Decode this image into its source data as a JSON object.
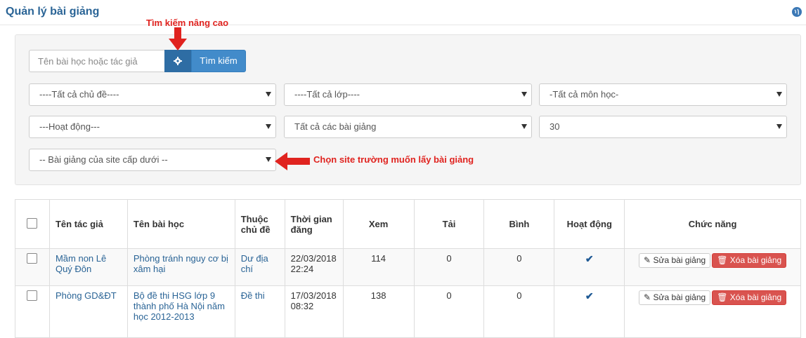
{
  "header": {
    "title": "Quản lý bài giảng"
  },
  "search": {
    "placeholder": "Tên bài học hoặc tác giả",
    "button_label": "Tìm kiếm"
  },
  "filters": {
    "topic": "----Tất cả chủ đề----",
    "grade": "----Tất cả lớp----",
    "subject": "-Tất cả môn học-",
    "status": "---Hoạt động---",
    "lesson_type": "Tất cả các bài giảng",
    "page_size": "30",
    "site": "-- Bài giảng của site cấp dưới --"
  },
  "annotations": {
    "advanced_search": "Tìm kiếm nâng cao",
    "choose_site": "Chọn site trường muốn lấy bài giảng"
  },
  "table": {
    "headers": {
      "author": "Tên tác giả",
      "lesson": "Tên bài học",
      "topic_1": "Thuộc",
      "topic_2": "chủ đề",
      "date_1": "Thời gian",
      "date_2": "đăng",
      "views": "Xem",
      "downloads": "Tải",
      "comments": "Bình",
      "active": "Hoạt động",
      "actions": "Chức năng"
    },
    "edit_label": "Sửa bài giảng",
    "delete_label": "Xóa bài giảng",
    "rows": [
      {
        "author": "Mầm non Lê Quý Đôn",
        "lesson": "Phòng tránh nguy cơ bị xâm hại",
        "topic": "Dư địa chí",
        "date": "22/03/2018",
        "time": "22:24",
        "views": "114",
        "downloads": "0",
        "comments": "0"
      },
      {
        "author": "Phòng GD&ĐT",
        "lesson": "Bộ đề thi HSG lớp 9 thành phố Hà Nội năm học 2012-2013",
        "topic": "Đề thi",
        "date": "17/03/2018",
        "time": "08:32",
        "views": "138",
        "downloads": "0",
        "comments": "0"
      }
    ]
  },
  "colors": {
    "accent": "#428bca",
    "danger": "#d9534f",
    "annotation": "#e0231f"
  }
}
